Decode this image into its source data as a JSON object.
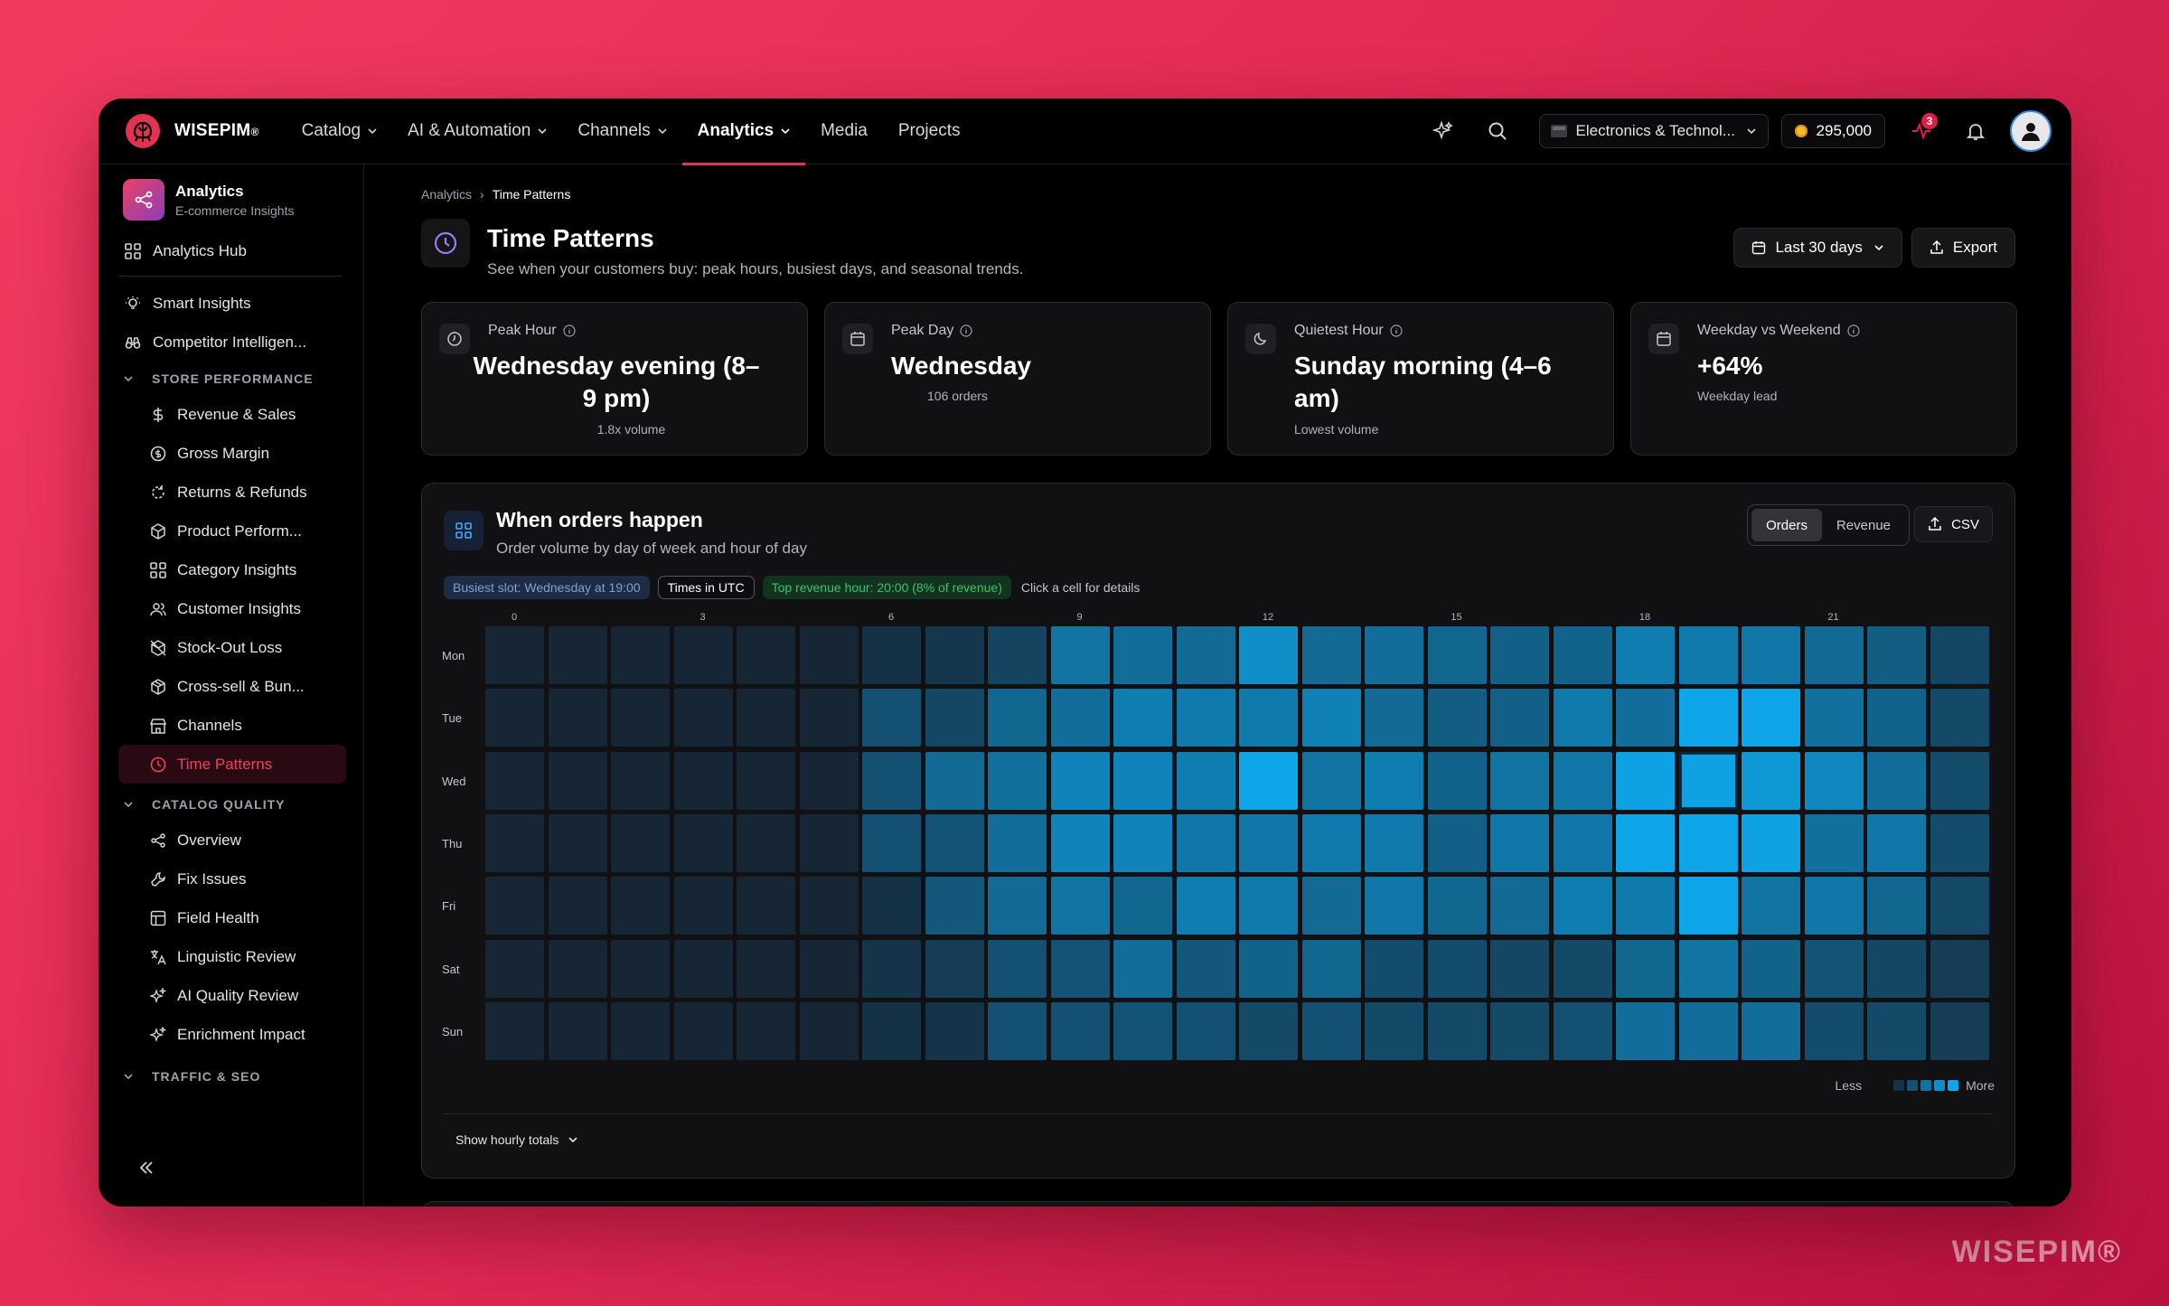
{
  "brand": {
    "name": "WISEPIM",
    "trademark": "®"
  },
  "watermark": "WISEPIM®",
  "nav": {
    "items": [
      {
        "label": "Catalog",
        "dropdown": true
      },
      {
        "label": "AI & Automation",
        "dropdown": true
      },
      {
        "label": "Channels",
        "dropdown": true
      },
      {
        "label": "Analytics",
        "dropdown": true,
        "active": true
      },
      {
        "label": "Media",
        "dropdown": false
      },
      {
        "label": "Projects",
        "dropdown": false
      }
    ],
    "store": "Electronics & Technol...",
    "credits": "295,000",
    "notification_badge": "3"
  },
  "sidebar": {
    "app_title": "Analytics",
    "app_subtitle": "E-commerce Insights",
    "hub": "Analytics Hub",
    "top_items": [
      "Smart Insights",
      "Competitor Intelligen..."
    ],
    "sections": [
      {
        "title": "STORE PERFORMANCE",
        "items": [
          "Revenue & Sales",
          "Gross Margin",
          "Returns & Refunds",
          "Product Perform...",
          "Category Insights",
          "Customer Insights",
          "Stock-Out Loss",
          "Cross-sell & Bun...",
          "Channels",
          "Time Patterns"
        ]
      },
      {
        "title": "CATALOG QUALITY",
        "items": [
          "Overview",
          "Fix Issues",
          "Field Health",
          "Linguistic Review",
          "AI Quality Review",
          "Enrichment Impact"
        ]
      },
      {
        "title": "TRAFFIC & SEO",
        "items": []
      }
    ],
    "active_item": "Time Patterns"
  },
  "breadcrumb": {
    "parent": "Analytics",
    "current": "Time Patterns"
  },
  "page": {
    "title": "Time Patterns",
    "subtitle": "See when your customers buy: peak hours, busiest days, and seasonal trends.",
    "range": "Last 30 days",
    "export": "Export"
  },
  "kpis": [
    {
      "label": "Peak Hour",
      "value": "Wednesday evening (8–9 pm)",
      "note": "1.8x volume",
      "icon": "clock-icon"
    },
    {
      "label": "Peak Day",
      "value": "Wednesday",
      "note": "106 orders",
      "icon": "calendar-icon"
    },
    {
      "label": "Quietest Hour",
      "value": "Sunday morning (4–6 am)",
      "note": "Lowest volume",
      "icon": "moon-icon"
    },
    {
      "label": "Weekday vs Weekend",
      "value": "+64%",
      "note": "Weekday lead",
      "icon": "calendar-icon"
    }
  ],
  "heatmap": {
    "title": "When orders happen",
    "subtitle": "Order volume by day of week and hour of day",
    "toggle": [
      "Orders",
      "Revenue"
    ],
    "toggle_selected": "Orders",
    "csv": "CSV",
    "chips": {
      "busiest": "Busiest slot: Wednesday at 19:00",
      "tz": "Times in UTC",
      "revenue": "Top revenue hour: 20:00 (8% of revenue)",
      "hint": "Click a cell for details"
    },
    "legend_less": "Less",
    "legend_more": "More",
    "legend_colors": [
      "#16324a",
      "#155173",
      "#13729f",
      "#0f8fc8",
      "#0ea5e9"
    ],
    "show_totals": "Show hourly totals",
    "hour_ticks": [
      "0",
      "3",
      "6",
      "9",
      "12",
      "15",
      "18",
      "21"
    ],
    "selected_cell": {
      "day": "Wed",
      "hour": 19
    }
  },
  "chart_data": {
    "type": "heatmap",
    "title": "When orders happen",
    "x": [
      0,
      1,
      2,
      3,
      4,
      5,
      6,
      7,
      8,
      9,
      10,
      11,
      12,
      13,
      14,
      15,
      16,
      17,
      18,
      19,
      20,
      21,
      22,
      23
    ],
    "y": [
      "Mon",
      "Tue",
      "Wed",
      "Thu",
      "Fri",
      "Sat",
      "Sun"
    ],
    "scale": "relative order volume, 0 (Less) to 4 (More)",
    "values": [
      [
        0,
        0,
        0,
        0,
        0,
        0,
        0.4,
        0.6,
        1.0,
        2.5,
        2.3,
        2.2,
        3.3,
        2.2,
        2.3,
        2.1,
        1.9,
        2.0,
        2.8,
        2.7,
        2.6,
        2.2,
        1.8,
        1.1
      ],
      [
        0,
        0,
        0,
        0,
        0,
        0,
        1.4,
        1.1,
        2.1,
        2.3,
        2.8,
        2.7,
        2.7,
        2.9,
        2.2,
        1.8,
        1.9,
        2.7,
        2.3,
        4.0,
        4.0,
        2.4,
        2.0,
        1.2
      ],
      [
        0,
        0,
        0,
        0,
        0,
        0,
        1.4,
        2.2,
        2.4,
        3.0,
        3.0,
        2.8,
        4.0,
        2.5,
        2.8,
        2.0,
        2.5,
        2.6,
        3.9,
        3.9,
        3.6,
        3.1,
        2.3,
        1.3
      ],
      [
        0,
        0,
        0,
        0,
        0,
        0,
        1.4,
        1.5,
        2.3,
        3.0,
        3.0,
        2.6,
        2.6,
        2.7,
        2.7,
        1.9,
        2.6,
        2.6,
        4.0,
        4.0,
        3.9,
        2.4,
        2.6,
        1.3
      ],
      [
        0,
        0,
        0,
        0,
        0,
        0,
        0.4,
        1.6,
        2.2,
        2.5,
        2.1,
        2.8,
        2.7,
        2.2,
        2.6,
        2.1,
        2.2,
        2.8,
        2.7,
        4.0,
        2.5,
        2.6,
        2.1,
        1.2
      ],
      [
        0,
        0,
        0,
        0,
        0,
        0,
        0.5,
        0.8,
        1.4,
        1.5,
        2.3,
        1.6,
        2.0,
        2.1,
        1.3,
        1.3,
        1.1,
        1.2,
        2.1,
        2.5,
        2.0,
        1.5,
        1.1,
        0.8
      ],
      [
        0,
        0,
        0,
        0,
        0,
        0,
        0.4,
        0.5,
        1.4,
        1.4,
        1.5,
        1.4,
        1.2,
        1.4,
        1.2,
        1.2,
        1.2,
        1.4,
        2.3,
        2.3,
        2.3,
        1.3,
        1.2,
        0.8
      ]
    ]
  }
}
